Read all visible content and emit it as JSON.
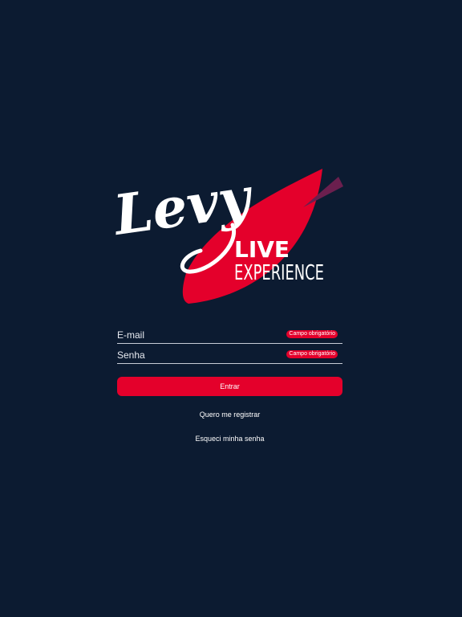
{
  "logo": {
    "script_text": "Levy",
    "line1": "LIVE",
    "line2": "EXPERIENCE"
  },
  "colors": {
    "background": "#0c1b31",
    "accent": "#e4002b",
    "leaf_dark": "#6b1f4e",
    "text": "#ffffff"
  },
  "form": {
    "email": {
      "placeholder": "E-mail",
      "value": "",
      "error": "Campo obrigatório"
    },
    "password": {
      "placeholder": "Senha",
      "value": "",
      "error": "Campo obrigatório"
    },
    "submit_label": "Entrar"
  },
  "links": {
    "register": "Quero me registrar",
    "forgot": "Esqueci minha senha"
  }
}
